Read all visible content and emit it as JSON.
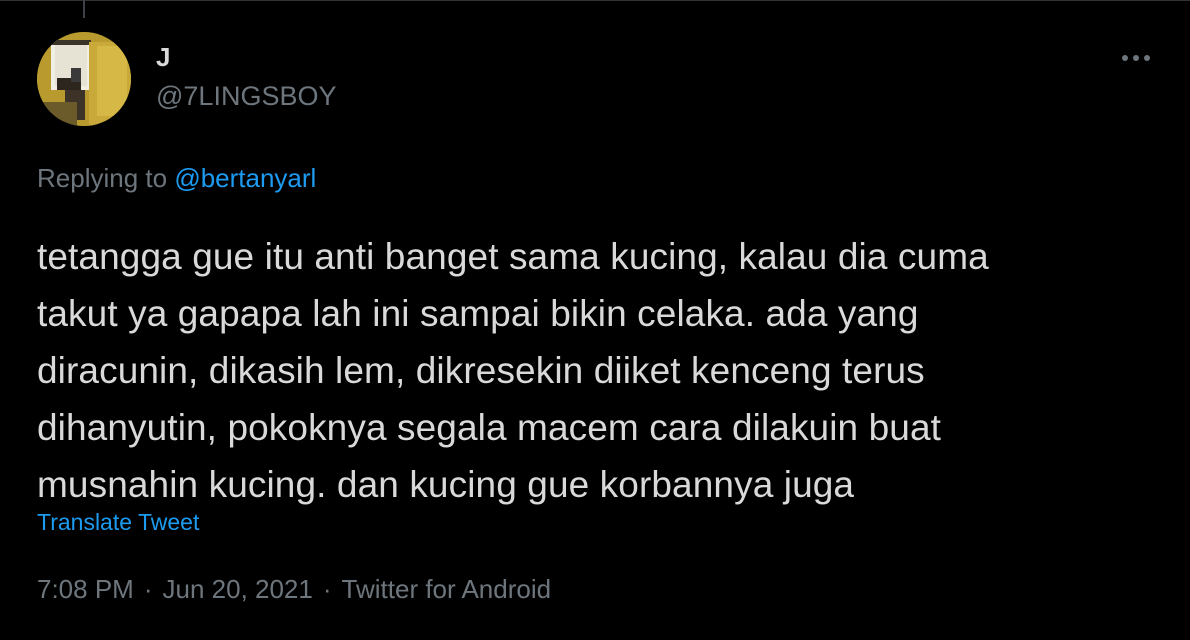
{
  "tweet": {
    "author": {
      "display_name": "J",
      "handle": "@7LINGSBOY"
    },
    "reply": {
      "prefix": "Replying to ",
      "mention": "@bertanyarl"
    },
    "text_lines": [
      "tetangga gue itu anti banget sama kucing, kalau dia cuma",
      "takut ya gapapa lah ini sampai bikin celaka. ada yang",
      "diracunin, dikasih lem, dikresekin diiket kenceng terus",
      "dihanyutin, pokoknya segala macem cara dilakuin buat",
      "musnahin kucing. dan kucing gue korbannya juga"
    ],
    "translate_label": "Translate Tweet",
    "meta": {
      "time": "7:08 PM",
      "separator": "·",
      "date": "Jun 20, 2021",
      "source": "Twitter for Android"
    }
  },
  "icons": {
    "more": "more-horizontal-icon",
    "avatar": "avatar-image"
  },
  "colors": {
    "background": "#000000",
    "text": "#d9d9d9",
    "muted": "#6e767d",
    "link": "#1d9bf0"
  }
}
